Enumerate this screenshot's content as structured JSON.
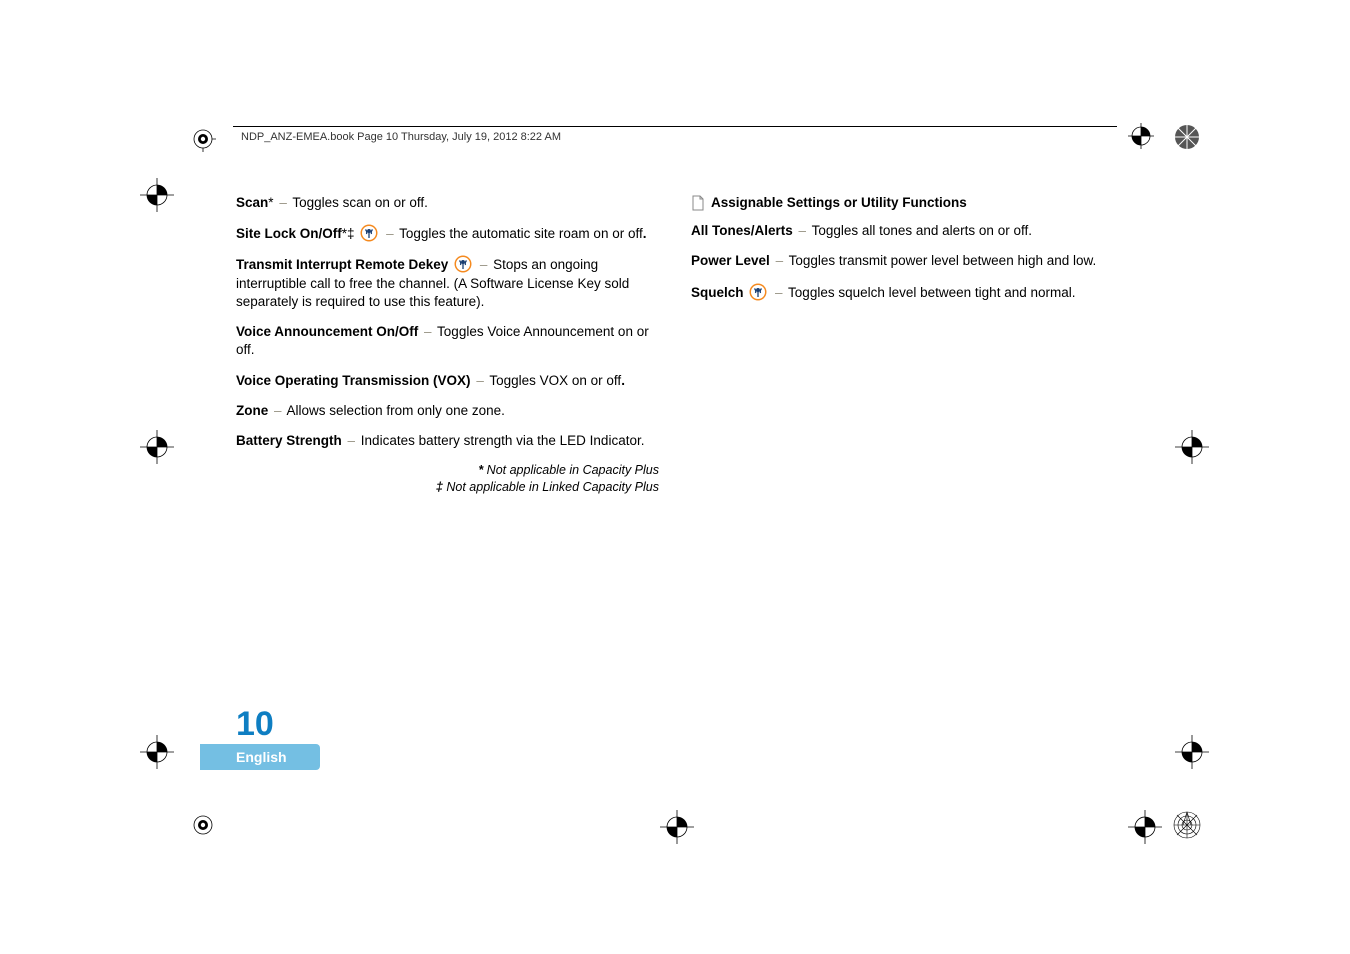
{
  "header": "NDP_ANZ-EMEA.book  Page 10  Thursday, July 19, 2012  8:22 AM",
  "left": {
    "scan_b": "Scan",
    "scan_sup": "*",
    "scan_rest": " Toggles scan on or off.",
    "sitelock_b": "Site Lock On/Off",
    "sitelock_sup": "*‡",
    "sitelock_rest_a": " Toggles the automatic site roam on or off",
    "sitelock_period": ".",
    "txi_b": "Transmit Interrupt Remote Dekey ",
    "txi_rest": " Stops an ongoing interruptible call to free the channel. (A Software License Key sold separately is required to use this feature).",
    "va_b": "Voice Announcement On/Off",
    "va_rest": " Toggles Voice Announcement on or off.",
    "vox_b": "Voice Operating Transmission (VOX)",
    "vox_rest": " Toggles VOX on or off",
    "vox_period": ".",
    "zone_b": "Zone",
    "zone_rest": " Allows selection from only one zone.",
    "bat_b": "Battery Strength",
    "bat_rest": " Indicates battery strength via the LED Indicator.",
    "fn1_sup": "*",
    "fn1": " Not applicable in Capacity Plus",
    "fn2_sup": "‡",
    "fn2": " Not applicable in Linked Capacity Plus"
  },
  "right": {
    "section_title": "Assignable Settings or Utility Functions",
    "tones_b": "All Tones/Alerts",
    "tones_rest": " Toggles all tones and alerts on or off.",
    "power_b": "Power Level",
    "power_rest": " Toggles transmit power level between high and low.",
    "squelch_b": "Squelch ",
    "squelch_rest": " Toggles squelch level between tight and normal."
  },
  "page_number": "10",
  "lang": "English"
}
